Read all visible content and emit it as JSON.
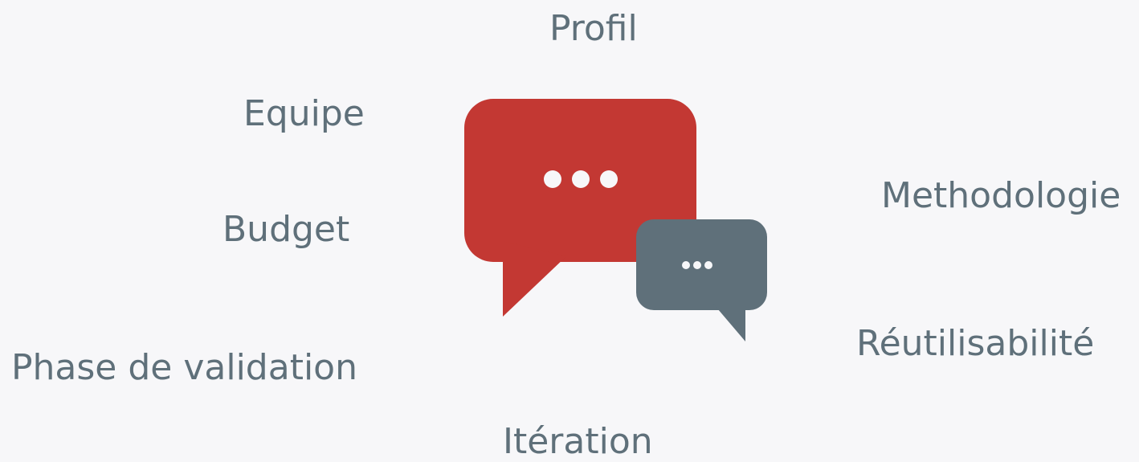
{
  "colors": {
    "background": "#f7f7f9",
    "text": "#5f707a",
    "bubble_large": "#c33833",
    "bubble_small": "#5f707a",
    "dots": "#f7f7f9"
  },
  "icons": {
    "large_bubble": "speech-bubble-icon",
    "small_bubble": "speech-bubble-icon"
  },
  "words": {
    "profil": "Profil",
    "equipe": "Equipe",
    "budget": "Budget",
    "phase_validation": "Phase de validation",
    "iteration": "Itération",
    "methodologie": "Methodologie",
    "reutilisabilite": "Réutilisabilité"
  }
}
